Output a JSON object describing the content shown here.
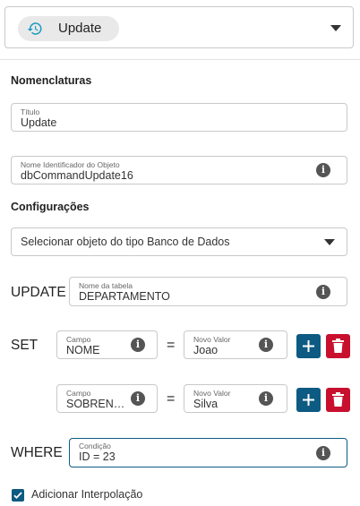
{
  "top_select": {
    "chip_label": "Update",
    "chip_icon": "history-icon"
  },
  "sections": {
    "nomenclaturas": "Nomenclaturas",
    "configuracoes": "Configurações"
  },
  "titulo": {
    "label": "Título",
    "value": "Update"
  },
  "nome_identificador": {
    "label": "Nome Identificador do Objeto",
    "value": "dbCommandUpdate16"
  },
  "db_object_select": {
    "placeholder": "Selecionar objeto do tipo Banco de Dados"
  },
  "update": {
    "keyword": "UPDATE",
    "label": "Nome da tabela",
    "value": "DEPARTAMENTO"
  },
  "set": {
    "keyword": "SET",
    "equals": "=",
    "rows": [
      {
        "campo_label": "Campo",
        "campo_value": "NOME",
        "valor_label": "Novo Valor",
        "valor_value": "Joao"
      },
      {
        "campo_label": "Campo",
        "campo_value": "SOBRENO...",
        "valor_label": "Novo Valor",
        "valor_value": "Silva"
      }
    ]
  },
  "where": {
    "keyword": "WHERE",
    "label": "Condição",
    "value": "ID = 23"
  },
  "interpolacao": {
    "label": "Adicionar Interpolação",
    "checked": true
  },
  "colors": {
    "primary": "#0d5a82",
    "danger": "#c8102e",
    "border": "#c9c9c9",
    "chip_bg": "#e9e9e9"
  }
}
